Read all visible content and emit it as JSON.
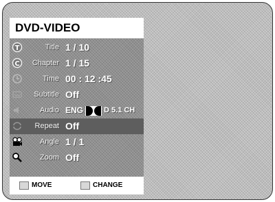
{
  "menu": {
    "title": "DVD-VIDEO",
    "items": [
      {
        "icon": "title-icon",
        "label": "Title",
        "value": "1 / 10"
      },
      {
        "icon": "chapter-icon",
        "label": "Chapter",
        "value": "1 / 15"
      },
      {
        "icon": "time-icon",
        "label": "Time",
        "value": "00 : 12 :45"
      },
      {
        "icon": "subtitle-icon",
        "label": "Subtitle",
        "value": "Off"
      },
      {
        "icon": "audio-icon",
        "label": "Audio",
        "value_lang": "ENG",
        "value_format": "D 5.1 CH"
      },
      {
        "icon": "repeat-icon",
        "label": "Repeat",
        "value": "Off",
        "selected": true
      },
      {
        "icon": "angle-icon",
        "label": "Angle",
        "value": "1 / 1"
      },
      {
        "icon": "zoom-icon",
        "label": "Zoom",
        "value": "Off"
      }
    ]
  },
  "footer": {
    "move_label": "MOVE",
    "change_label": "CHANGE"
  }
}
